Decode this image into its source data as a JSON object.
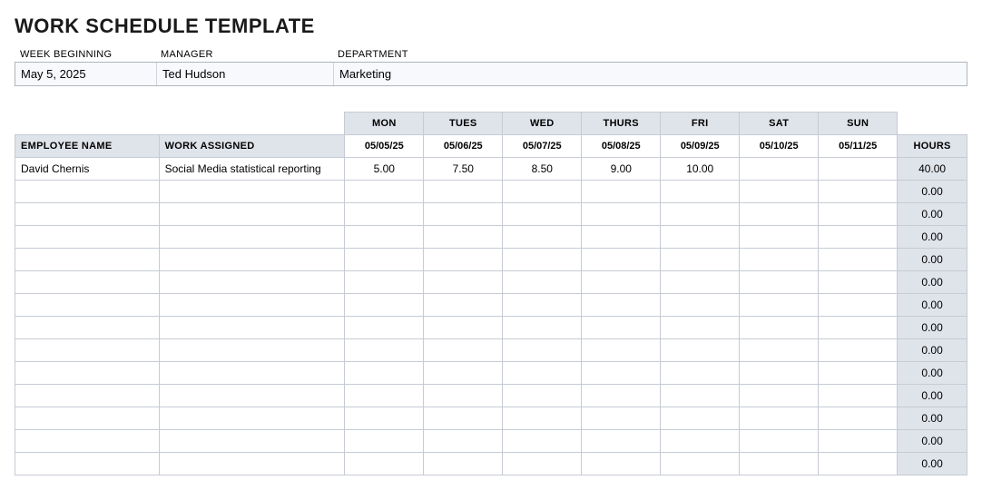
{
  "title": "WORK SCHEDULE TEMPLATE",
  "meta": {
    "labels": {
      "week": "WEEK BEGINNING",
      "manager": "MANAGER",
      "department": "DEPARTMENT"
    },
    "values": {
      "week": "May 5, 2025",
      "manager": "Ted Hudson",
      "department": "Marketing"
    }
  },
  "headers": {
    "employee": "EMPLOYEE NAME",
    "work": "WORK ASSIGNED",
    "days": [
      "MON",
      "TUES",
      "WED",
      "THURS",
      "FRI",
      "SAT",
      "SUN"
    ],
    "dates": [
      "05/05/25",
      "05/06/25",
      "05/07/25",
      "05/08/25",
      "05/09/25",
      "05/10/25",
      "05/11/25"
    ],
    "hours": "HOURS"
  },
  "rows": [
    {
      "employee": "David Chernis",
      "work": "Social Media statistical reporting",
      "d": [
        "5.00",
        "7.50",
        "8.50",
        "9.00",
        "10.00",
        "",
        ""
      ],
      "hours": "40.00"
    },
    {
      "employee": "",
      "work": "",
      "d": [
        "",
        "",
        "",
        "",
        "",
        "",
        ""
      ],
      "hours": "0.00"
    },
    {
      "employee": "",
      "work": "",
      "d": [
        "",
        "",
        "",
        "",
        "",
        "",
        ""
      ],
      "hours": "0.00"
    },
    {
      "employee": "",
      "work": "",
      "d": [
        "",
        "",
        "",
        "",
        "",
        "",
        ""
      ],
      "hours": "0.00"
    },
    {
      "employee": "",
      "work": "",
      "d": [
        "",
        "",
        "",
        "",
        "",
        "",
        ""
      ],
      "hours": "0.00"
    },
    {
      "employee": "",
      "work": "",
      "d": [
        "",
        "",
        "",
        "",
        "",
        "",
        ""
      ],
      "hours": "0.00"
    },
    {
      "employee": "",
      "work": "",
      "d": [
        "",
        "",
        "",
        "",
        "",
        "",
        ""
      ],
      "hours": "0.00"
    },
    {
      "employee": "",
      "work": "",
      "d": [
        "",
        "",
        "",
        "",
        "",
        "",
        ""
      ],
      "hours": "0.00"
    },
    {
      "employee": "",
      "work": "",
      "d": [
        "",
        "",
        "",
        "",
        "",
        "",
        ""
      ],
      "hours": "0.00"
    },
    {
      "employee": "",
      "work": "",
      "d": [
        "",
        "",
        "",
        "",
        "",
        "",
        ""
      ],
      "hours": "0.00"
    },
    {
      "employee": "",
      "work": "",
      "d": [
        "",
        "",
        "",
        "",
        "",
        "",
        ""
      ],
      "hours": "0.00"
    },
    {
      "employee": "",
      "work": "",
      "d": [
        "",
        "",
        "",
        "",
        "",
        "",
        ""
      ],
      "hours": "0.00"
    },
    {
      "employee": "",
      "work": "",
      "d": [
        "",
        "",
        "",
        "",
        "",
        "",
        ""
      ],
      "hours": "0.00"
    },
    {
      "employee": "",
      "work": "",
      "d": [
        "",
        "",
        "",
        "",
        "",
        "",
        ""
      ],
      "hours": "0.00"
    }
  ]
}
